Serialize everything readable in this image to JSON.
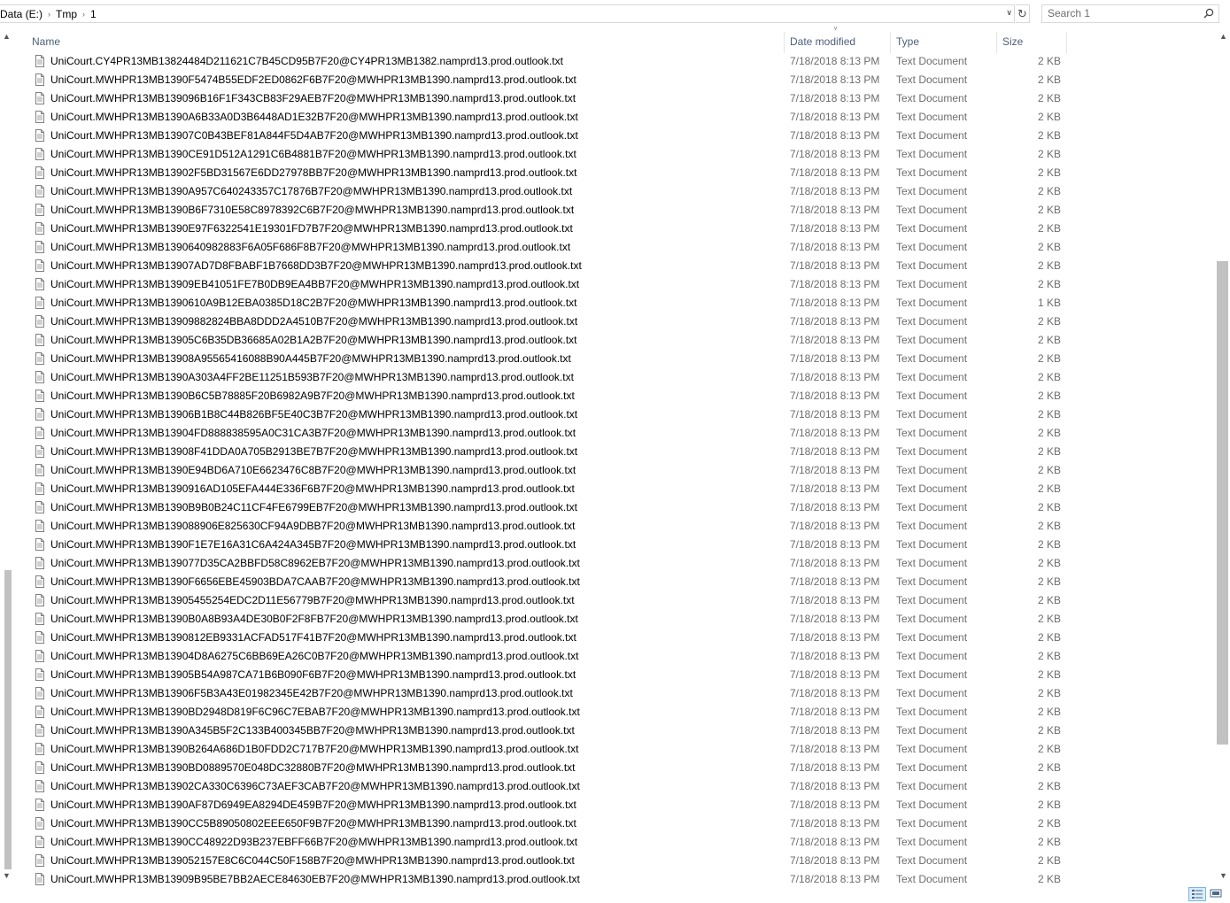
{
  "address": {
    "crumbs": [
      "Data (E:)",
      "Tmp",
      "1"
    ],
    "dropdown_icon": "chevron-down-icon",
    "refresh_icon": "refresh-icon"
  },
  "search": {
    "placeholder": "Search 1",
    "icon": "search-icon"
  },
  "columns": {
    "name": "Name",
    "date": "Date modified",
    "type": "Type",
    "size": "Size"
  },
  "files": [
    {
      "name": "UniCourt.CY4PR13MB13824484D211621C7B45CD95B7F20@CY4PR13MB1382.namprd13.prod.outlook.txt",
      "date": "7/18/2018 8:13 PM",
      "type": "Text Document",
      "size": "2 KB"
    },
    {
      "name": "UniCourt.MWHPR13MB1390F5474B55EDF2ED0862F6B7F20@MWHPR13MB1390.namprd13.prod.outlook.txt",
      "date": "7/18/2018 8:13 PM",
      "type": "Text Document",
      "size": "2 KB"
    },
    {
      "name": "UniCourt.MWHPR13MB139096B16F1F343CB83F29AEB7F20@MWHPR13MB1390.namprd13.prod.outlook.txt",
      "date": "7/18/2018 8:13 PM",
      "type": "Text Document",
      "size": "2 KB"
    },
    {
      "name": "UniCourt.MWHPR13MB1390A6B33A0D3B6448AD1E32B7F20@MWHPR13MB1390.namprd13.prod.outlook.txt",
      "date": "7/18/2018 8:13 PM",
      "type": "Text Document",
      "size": "2 KB"
    },
    {
      "name": "UniCourt.MWHPR13MB13907C0B43BEF81A844F5D4AB7F20@MWHPR13MB1390.namprd13.prod.outlook.txt",
      "date": "7/18/2018 8:13 PM",
      "type": "Text Document",
      "size": "2 KB"
    },
    {
      "name": "UniCourt.MWHPR13MB1390CE91D512A1291C6B4881B7F20@MWHPR13MB1390.namprd13.prod.outlook.txt",
      "date": "7/18/2018 8:13 PM",
      "type": "Text Document",
      "size": "2 KB"
    },
    {
      "name": "UniCourt.MWHPR13MB13902F5BD31567E6DD27978BB7F20@MWHPR13MB1390.namprd13.prod.outlook.txt",
      "date": "7/18/2018 8:13 PM",
      "type": "Text Document",
      "size": "2 KB"
    },
    {
      "name": "UniCourt.MWHPR13MB1390A957C640243357C17876B7F20@MWHPR13MB1390.namprd13.prod.outlook.txt",
      "date": "7/18/2018 8:13 PM",
      "type": "Text Document",
      "size": "2 KB"
    },
    {
      "name": "UniCourt.MWHPR13MB1390B6F7310E58C8978392C6B7F20@MWHPR13MB1390.namprd13.prod.outlook.txt",
      "date": "7/18/2018 8:13 PM",
      "type": "Text Document",
      "size": "2 KB"
    },
    {
      "name": "UniCourt.MWHPR13MB1390E97F6322541E19301FD7B7F20@MWHPR13MB1390.namprd13.prod.outlook.txt",
      "date": "7/18/2018 8:13 PM",
      "type": "Text Document",
      "size": "2 KB"
    },
    {
      "name": "UniCourt.MWHPR13MB1390640982883F6A05F686F8B7F20@MWHPR13MB1390.namprd13.prod.outlook.txt",
      "date": "7/18/2018 8:13 PM",
      "type": "Text Document",
      "size": "2 KB"
    },
    {
      "name": "UniCourt.MWHPR13MB13907AD7D8FBABF1B7668DD3B7F20@MWHPR13MB1390.namprd13.prod.outlook.txt",
      "date": "7/18/2018 8:13 PM",
      "type": "Text Document",
      "size": "2 KB"
    },
    {
      "name": "UniCourt.MWHPR13MB13909EB41051FE7B0DB9EA4BB7F20@MWHPR13MB1390.namprd13.prod.outlook.txt",
      "date": "7/18/2018 8:13 PM",
      "type": "Text Document",
      "size": "2 KB"
    },
    {
      "name": "UniCourt.MWHPR13MB1390610A9B12EBA0385D18C2B7F20@MWHPR13MB1390.namprd13.prod.outlook.txt",
      "date": "7/18/2018 8:13 PM",
      "type": "Text Document",
      "size": "1 KB"
    },
    {
      "name": "UniCourt.MWHPR13MB13909882824BBA8DDD2A4510B7F20@MWHPR13MB1390.namprd13.prod.outlook.txt",
      "date": "7/18/2018 8:13 PM",
      "type": "Text Document",
      "size": "2 KB"
    },
    {
      "name": "UniCourt.MWHPR13MB13905C6B35DB36685A02B1A2B7F20@MWHPR13MB1390.namprd13.prod.outlook.txt",
      "date": "7/18/2018 8:13 PM",
      "type": "Text Document",
      "size": "2 KB"
    },
    {
      "name": "UniCourt.MWHPR13MB13908A95565416088B90A445B7F20@MWHPR13MB1390.namprd13.prod.outlook.txt",
      "date": "7/18/2018 8:13 PM",
      "type": "Text Document",
      "size": "2 KB"
    },
    {
      "name": "UniCourt.MWHPR13MB1390A303A4FF2BE11251B593B7F20@MWHPR13MB1390.namprd13.prod.outlook.txt",
      "date": "7/18/2018 8:13 PM",
      "type": "Text Document",
      "size": "2 KB"
    },
    {
      "name": "UniCourt.MWHPR13MB1390B6C5B78885F20B6982A9B7F20@MWHPR13MB1390.namprd13.prod.outlook.txt",
      "date": "7/18/2018 8:13 PM",
      "type": "Text Document",
      "size": "2 KB"
    },
    {
      "name": "UniCourt.MWHPR13MB13906B1B8C44B826BF5E40C3B7F20@MWHPR13MB1390.namprd13.prod.outlook.txt",
      "date": "7/18/2018 8:13 PM",
      "type": "Text Document",
      "size": "2 KB"
    },
    {
      "name": "UniCourt.MWHPR13MB13904FD888838595A0C31CA3B7F20@MWHPR13MB1390.namprd13.prod.outlook.txt",
      "date": "7/18/2018 8:13 PM",
      "type": "Text Document",
      "size": "2 KB"
    },
    {
      "name": "UniCourt.MWHPR13MB13908F41DDA0A705B2913BE7B7F20@MWHPR13MB1390.namprd13.prod.outlook.txt",
      "date": "7/18/2018 8:13 PM",
      "type": "Text Document",
      "size": "2 KB"
    },
    {
      "name": "UniCourt.MWHPR13MB1390E94BD6A710E6623476C8B7F20@MWHPR13MB1390.namprd13.prod.outlook.txt",
      "date": "7/18/2018 8:13 PM",
      "type": "Text Document",
      "size": "2 KB"
    },
    {
      "name": "UniCourt.MWHPR13MB1390916AD105EFA444E336F6B7F20@MWHPR13MB1390.namprd13.prod.outlook.txt",
      "date": "7/18/2018 8:13 PM",
      "type": "Text Document",
      "size": "2 KB"
    },
    {
      "name": "UniCourt.MWHPR13MB1390B9B0B24C11CF4FE6799EB7F20@MWHPR13MB1390.namprd13.prod.outlook.txt",
      "date": "7/18/2018 8:13 PM",
      "type": "Text Document",
      "size": "2 KB"
    },
    {
      "name": "UniCourt.MWHPR13MB139088906E825630CF94A9DBB7F20@MWHPR13MB1390.namprd13.prod.outlook.txt",
      "date": "7/18/2018 8:13 PM",
      "type": "Text Document",
      "size": "2 KB"
    },
    {
      "name": "UniCourt.MWHPR13MB1390F1E7E16A31C6A424A345B7F20@MWHPR13MB1390.namprd13.prod.outlook.txt",
      "date": "7/18/2018 8:13 PM",
      "type": "Text Document",
      "size": "2 KB"
    },
    {
      "name": "UniCourt.MWHPR13MB139077D35CA2BBFD58C8962EB7F20@MWHPR13MB1390.namprd13.prod.outlook.txt",
      "date": "7/18/2018 8:13 PM",
      "type": "Text Document",
      "size": "2 KB"
    },
    {
      "name": "UniCourt.MWHPR13MB1390F6656EBE45903BDA7CAAB7F20@MWHPR13MB1390.namprd13.prod.outlook.txt",
      "date": "7/18/2018 8:13 PM",
      "type": "Text Document",
      "size": "2 KB"
    },
    {
      "name": "UniCourt.MWHPR13MB13905455254EDC2D11E56779B7F20@MWHPR13MB1390.namprd13.prod.outlook.txt",
      "date": "7/18/2018 8:13 PM",
      "type": "Text Document",
      "size": "2 KB"
    },
    {
      "name": "UniCourt.MWHPR13MB1390B0A8B93A4DE30B0F2F8FB7F20@MWHPR13MB1390.namprd13.prod.outlook.txt",
      "date": "7/18/2018 8:13 PM",
      "type": "Text Document",
      "size": "2 KB"
    },
    {
      "name": "UniCourt.MWHPR13MB1390812EB9331ACFAD517F41B7F20@MWHPR13MB1390.namprd13.prod.outlook.txt",
      "date": "7/18/2018 8:13 PM",
      "type": "Text Document",
      "size": "2 KB"
    },
    {
      "name": "UniCourt.MWHPR13MB13904D8A6275C6BB69EA26C0B7F20@MWHPR13MB1390.namprd13.prod.outlook.txt",
      "date": "7/18/2018 8:13 PM",
      "type": "Text Document",
      "size": "2 KB"
    },
    {
      "name": "UniCourt.MWHPR13MB13905B54A987CA71B6B090F6B7F20@MWHPR13MB1390.namprd13.prod.outlook.txt",
      "date": "7/18/2018 8:13 PM",
      "type": "Text Document",
      "size": "2 KB"
    },
    {
      "name": "UniCourt.MWHPR13MB13906F5B3A43E01982345E42B7F20@MWHPR13MB1390.namprd13.prod.outlook.txt",
      "date": "7/18/2018 8:13 PM",
      "type": "Text Document",
      "size": "2 KB"
    },
    {
      "name": "UniCourt.MWHPR13MB1390BD2948D819F6C96C7EBAB7F20@MWHPR13MB1390.namprd13.prod.outlook.txt",
      "date": "7/18/2018 8:13 PM",
      "type": "Text Document",
      "size": "2 KB"
    },
    {
      "name": "UniCourt.MWHPR13MB1390A345B5F2C133B400345BB7F20@MWHPR13MB1390.namprd13.prod.outlook.txt",
      "date": "7/18/2018 8:13 PM",
      "type": "Text Document",
      "size": "2 KB"
    },
    {
      "name": "UniCourt.MWHPR13MB1390B264A686D1B0FDD2C717B7F20@MWHPR13MB1390.namprd13.prod.outlook.txt",
      "date": "7/18/2018 8:13 PM",
      "type": "Text Document",
      "size": "2 KB"
    },
    {
      "name": "UniCourt.MWHPR13MB1390BD0889570E048DC32880B7F20@MWHPR13MB1390.namprd13.prod.outlook.txt",
      "date": "7/18/2018 8:13 PM",
      "type": "Text Document",
      "size": "2 KB"
    },
    {
      "name": "UniCourt.MWHPR13MB13902CA330C6396C73AEF3CAB7F20@MWHPR13MB1390.namprd13.prod.outlook.txt",
      "date": "7/18/2018 8:13 PM",
      "type": "Text Document",
      "size": "2 KB"
    },
    {
      "name": "UniCourt.MWHPR13MB1390AF87D6949EA8294DE459B7F20@MWHPR13MB1390.namprd13.prod.outlook.txt",
      "date": "7/18/2018 8:13 PM",
      "type": "Text Document",
      "size": "2 KB"
    },
    {
      "name": "UniCourt.MWHPR13MB1390CC5B89050802EEE650F9B7F20@MWHPR13MB1390.namprd13.prod.outlook.txt",
      "date": "7/18/2018 8:13 PM",
      "type": "Text Document",
      "size": "2 KB"
    },
    {
      "name": "UniCourt.MWHPR13MB1390CC48922D93B237EBFF66B7F20@MWHPR13MB1390.namprd13.prod.outlook.txt",
      "date": "7/18/2018 8:13 PM",
      "type": "Text Document",
      "size": "2 KB"
    },
    {
      "name": "UniCourt.MWHPR13MB139052157E8C6C044C50F158B7F20@MWHPR13MB1390.namprd13.prod.outlook.txt",
      "date": "7/18/2018 8:13 PM",
      "type": "Text Document",
      "size": "2 KB"
    },
    {
      "name": "UniCourt.MWHPR13MB13909B95BE7BB2AECE84630EB7F20@MWHPR13MB1390.namprd13.prod.outlook.txt",
      "date": "7/18/2018 8:13 PM",
      "type": "Text Document",
      "size": "2 KB"
    }
  ],
  "icons": {
    "file": "text-file-icon"
  },
  "status_bar": {
    "details_view_icon": "details-view-icon",
    "tiles_view_icon": "large-icons-view-icon"
  }
}
